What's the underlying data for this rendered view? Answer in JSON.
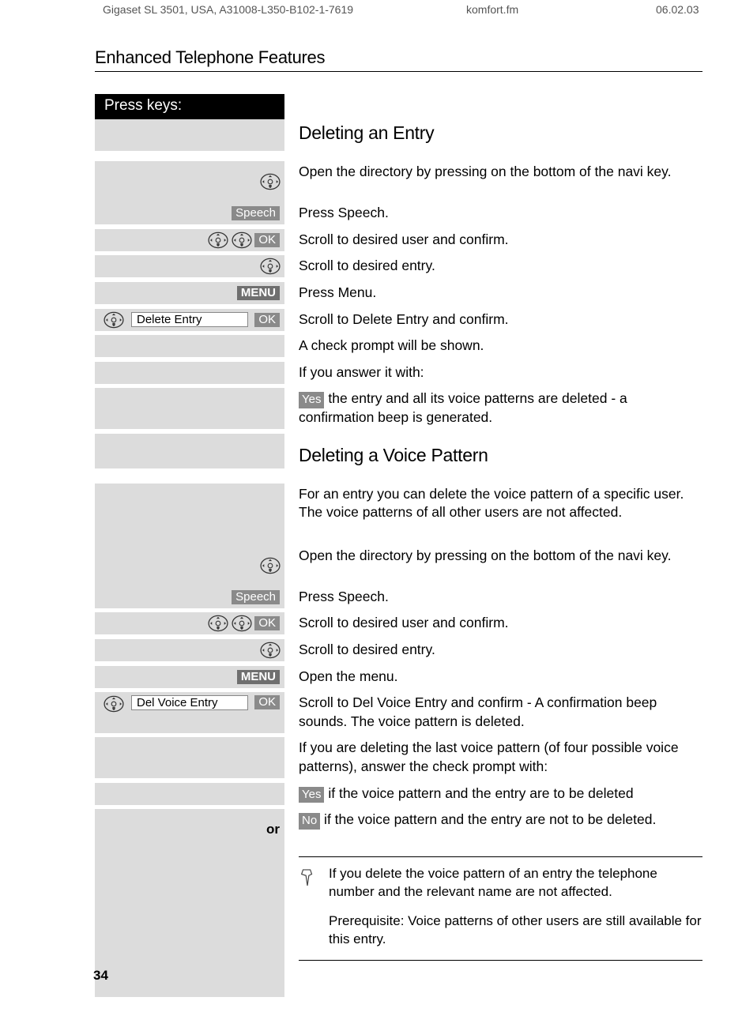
{
  "header": {
    "doc_id": "Gigaset SL 3501, USA, A31008-L350-B102-1-7619",
    "file": "komfort.fm",
    "date": "06.02.03"
  },
  "section_title": "Enhanced Telephone Features",
  "press_keys": "Press keys:",
  "headings": {
    "del_entry": "Deleting an Entry",
    "del_voice": "Deleting a Voice Pattern"
  },
  "labels": {
    "speech": "Speech",
    "ok": "OK",
    "menu": "MENU",
    "yes": "Yes",
    "no": "No",
    "or": "or",
    "delete_entry": "Delete Entry",
    "del_voice_entry": "Del Voice Entry"
  },
  "steps1": {
    "s1": "Open the directory by pressing on the bottom of the navi key.",
    "s2": "Press Speech.",
    "s3": "Scroll to desired user and confirm.",
    "s4": "Scroll to desired entry.",
    "s5": "Press Menu.",
    "s6": "Scroll to Delete Entry and confirm.",
    "s7": "A check prompt will be shown.",
    "s8": "If you answer it with:",
    "s9_after_yes": " the entry and all its voice patterns are deleted - a confirmation beep is generated."
  },
  "intro2": "For an entry you can delete the voice pattern of a specific user. The voice patterns of all other users are not affected.",
  "steps2": {
    "s1": "Open the directory by pressing on the bottom of the navi key.",
    "s2": "Press Speech.",
    "s3": "Scroll to desired user and confirm.",
    "s4": "Scroll to desired entry.",
    "s5": "Open the menu.",
    "s6": "Scroll to Del Voice Entry and confirm - A confirmation beep sounds. The voice pattern is deleted.",
    "s7": "If you are deleting the last voice pattern (of four possible voice patterns), answer the check prompt with:",
    "s8_after_yes": " if the voice pattern and the entry are to be deleted",
    "s9_after_no": " if the voice pattern and the entry are not to be deleted."
  },
  "note": {
    "p1": "If you delete the voice pattern of an entry the telephone number and the relevant name are not affected.",
    "p2": "Prerequisite: Voice patterns of other users are still available for this entry."
  },
  "page_number": "34"
}
